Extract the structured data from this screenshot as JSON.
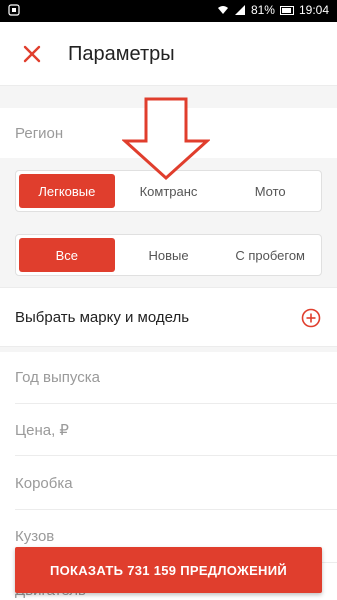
{
  "status_bar": {
    "battery": "81%",
    "time": "19:04"
  },
  "appbar": {
    "title": "Параметры",
    "close_icon": "close-icon"
  },
  "filters": {
    "region_label": "Регион",
    "vehicle_type": {
      "options": [
        "Легковые",
        "Комтранс",
        "Мото"
      ],
      "selected": "Легковые"
    },
    "condition": {
      "options": [
        "Все",
        "Новые",
        "С пробегом"
      ],
      "selected": "Все"
    },
    "model_label": "Выбрать марку и модель",
    "fields": [
      "Год выпуска",
      "Цена, ₽",
      "Коробка",
      "Кузов",
      "Двигатель"
    ]
  },
  "cta": {
    "label": "ПОКАЗАТЬ 731 159 ПРЕДЛОЖЕНИЙ"
  },
  "colors": {
    "accent": "#e03e2d",
    "background": "#f5f5f5"
  }
}
